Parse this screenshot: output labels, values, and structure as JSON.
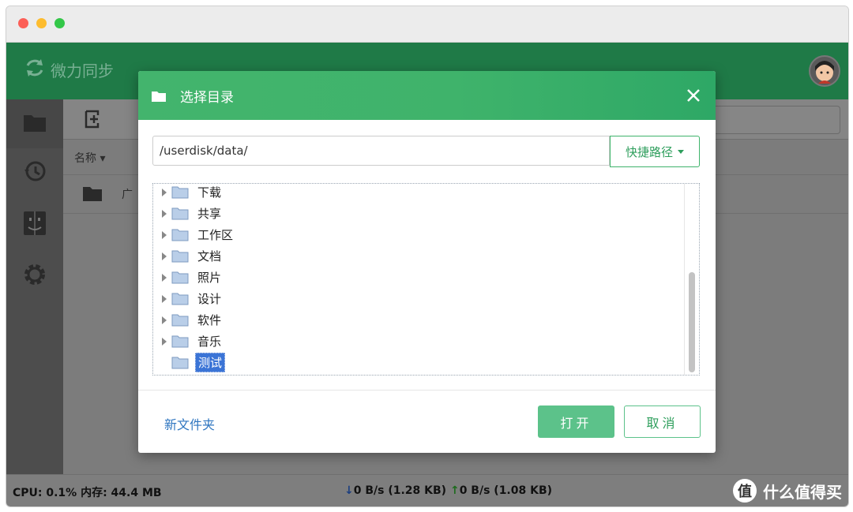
{
  "app": {
    "name": "微力同步"
  },
  "sidebar": {
    "items": [
      {
        "icon": "folder-icon"
      },
      {
        "icon": "history-icon"
      },
      {
        "icon": "finder-icon"
      },
      {
        "icon": "gear-icon"
      }
    ]
  },
  "content": {
    "column_name": "名称",
    "rows": [
      {
        "name": "广"
      }
    ]
  },
  "dialog": {
    "title": "选择目录",
    "path_value": "/userdisk/data/",
    "quick_path_label": "快捷路径",
    "tree": [
      {
        "label": "下载",
        "expandable": true,
        "selected": false
      },
      {
        "label": "共享",
        "expandable": true,
        "selected": false
      },
      {
        "label": "工作区",
        "expandable": true,
        "selected": false
      },
      {
        "label": "文档",
        "expandable": true,
        "selected": false
      },
      {
        "label": "照片",
        "expandable": true,
        "selected": false
      },
      {
        "label": "设计",
        "expandable": true,
        "selected": false
      },
      {
        "label": "软件",
        "expandable": true,
        "selected": false
      },
      {
        "label": "音乐",
        "expandable": true,
        "selected": false
      },
      {
        "label": "测试",
        "expandable": false,
        "selected": true
      }
    ],
    "new_folder_label": "新文件夹",
    "open_label": "打开",
    "cancel_label": "取消"
  },
  "status": {
    "cpu": "CPU: 0.1% 内存: 44.4 MB",
    "download": "0 B/s (1.28 KB)",
    "upload": "0 B/s (1.08 KB)"
  },
  "watermark": {
    "badge": "值",
    "text": "什么值得买"
  },
  "colors": {
    "brand_green": "#43b46d",
    "header_dark_green": "#1f7a47",
    "selection_blue": "#3b74d6",
    "link_blue": "#2f76c0"
  }
}
